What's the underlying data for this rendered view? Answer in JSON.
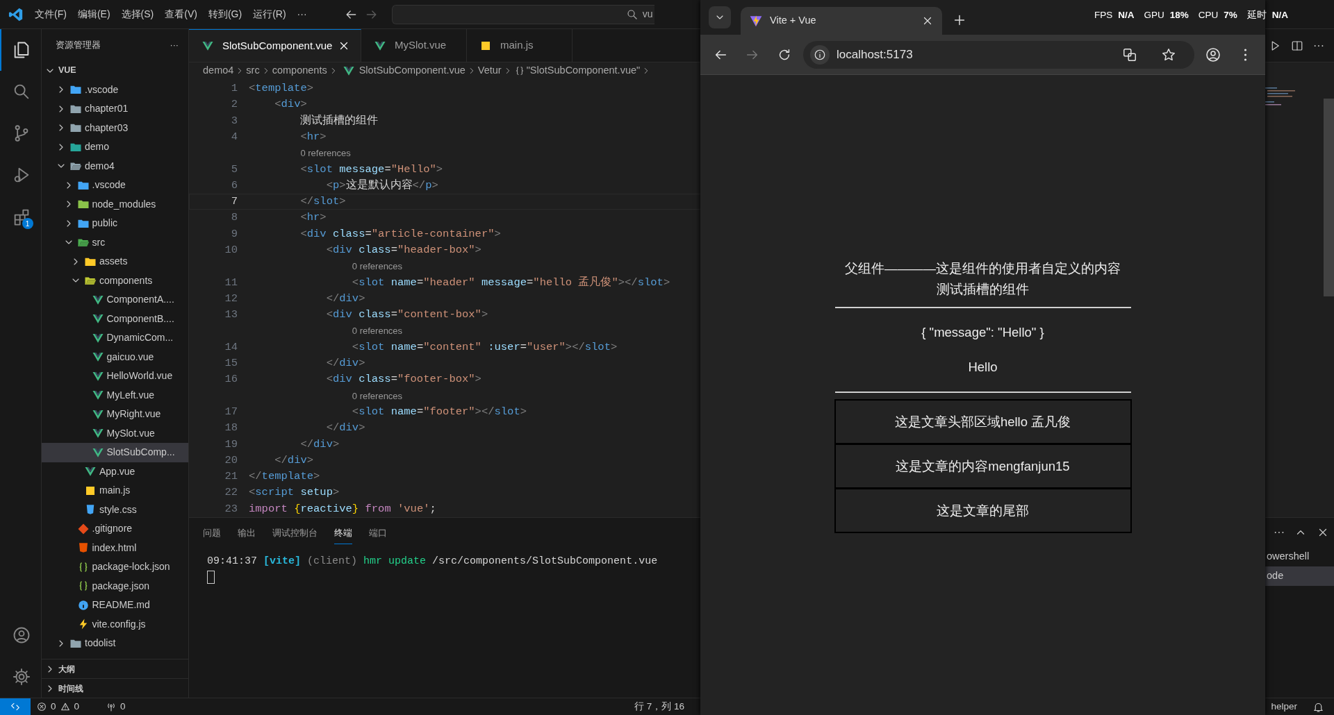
{
  "title_bar": {
    "menu": [
      "文件(F)",
      "编辑(E)",
      "选择(S)",
      "查看(V)",
      "转到(G)",
      "运行(R)"
    ],
    "more": "···",
    "nav": [
      {
        "kind": "back",
        "disabled": false
      },
      {
        "kind": "forward",
        "disabled": true
      }
    ],
    "search": {
      "value": "vu"
    }
  },
  "activity_bar": {
    "items": [
      {
        "kind": "explorer",
        "selected": true
      },
      {
        "kind": "search",
        "selected": false
      },
      {
        "kind": "source-control",
        "selected": false
      },
      {
        "kind": "run-debug",
        "selected": false
      },
      {
        "kind": "extensions",
        "selected": false,
        "badge": "1"
      }
    ],
    "bottom": [
      {
        "kind": "account"
      },
      {
        "kind": "settings"
      }
    ]
  },
  "sidebar": {
    "title": "资源管理器",
    "more": "···",
    "root": {
      "label": "VUE",
      "expanded": true
    },
    "tree": [
      {
        "label": ".vscode",
        "kind": "folder-vscode",
        "expanded": false,
        "selected": false
      },
      {
        "label": "chapter01",
        "kind": "folder",
        "expanded": false,
        "selected": false
      },
      {
        "label": "chapter03",
        "kind": "folder",
        "expanded": false,
        "selected": false
      },
      {
        "label": "demo",
        "kind": "folder-media",
        "expanded": false,
        "selected": false
      },
      {
        "label": "demo4",
        "kind": "folder",
        "expanded": true,
        "selected": false,
        "children": [
          {
            "label": ".vscode",
            "kind": "folder-vscode",
            "expanded": false,
            "selected": false
          },
          {
            "label": "node_modules",
            "kind": "folder-node",
            "expanded": false,
            "selected": false
          },
          {
            "label": "public",
            "kind": "folder-public",
            "expanded": false,
            "selected": false
          },
          {
            "label": "src",
            "kind": "folder-src",
            "expanded": true,
            "selected": false,
            "children": [
              {
                "label": "assets",
                "kind": "folder-assets",
                "expanded": false,
                "selected": false
              },
              {
                "label": "components",
                "kind": "folder-components",
                "expanded": true,
                "selected": false,
                "children": [
                  {
                    "label": "ComponentA....",
                    "kind": "vue",
                    "selected": false
                  },
                  {
                    "label": "ComponentB....",
                    "kind": "vue",
                    "selected": false
                  },
                  {
                    "label": "DynamicCom...",
                    "kind": "vue",
                    "selected": false
                  },
                  {
                    "label": "gaicuo.vue",
                    "kind": "vue",
                    "selected": false
                  },
                  {
                    "label": "HelloWorld.vue",
                    "kind": "vue",
                    "selected": false
                  },
                  {
                    "label": "MyLeft.vue",
                    "kind": "vue",
                    "selected": false
                  },
                  {
                    "label": "MyRight.vue",
                    "kind": "vue",
                    "selected": false
                  },
                  {
                    "label": "MySlot.vue",
                    "kind": "vue",
                    "selected": false
                  },
                  {
                    "label": "SlotSubComp...",
                    "kind": "vue",
                    "selected": true
                  }
                ]
              },
              {
                "label": "App.vue",
                "kind": "vue",
                "selected": false
              },
              {
                "label": "main.js",
                "kind": "js",
                "selected": false
              },
              {
                "label": "style.css",
                "kind": "css",
                "selected": false
              }
            ]
          },
          {
            "label": ".gitignore",
            "kind": "git",
            "selected": false
          },
          {
            "label": "index.html",
            "kind": "html",
            "selected": false
          },
          {
            "label": "package-lock.json",
            "kind": "json",
            "selected": false
          },
          {
            "label": "package.json",
            "kind": "json",
            "selected": false
          },
          {
            "label": "README.md",
            "kind": "info",
            "selected": false
          },
          {
            "label": "vite.config.js",
            "kind": "vite",
            "selected": false
          }
        ]
      },
      {
        "label": "todolist",
        "kind": "folder",
        "expanded": false,
        "selected": false
      }
    ],
    "sections": [
      {
        "label": "大纲",
        "expanded": false
      },
      {
        "label": "时间线",
        "expanded": false
      }
    ]
  },
  "editor": {
    "tabs": [
      {
        "label": "SlotSubComponent.vue",
        "kind": "vue",
        "selected": true
      },
      {
        "label": "MySlot.vue",
        "kind": "vue",
        "selected": false
      },
      {
        "label": "main.js",
        "kind": "js",
        "selected": false
      }
    ],
    "breadcrumbs": [
      {
        "label": "demo4",
        "kind": "plain"
      },
      {
        "label": "src",
        "kind": "plain"
      },
      {
        "label": "components",
        "kind": "plain"
      },
      {
        "label": "SlotSubComponent.vue",
        "kind": "vue"
      },
      {
        "label": "Vetur",
        "kind": "plain"
      },
      {
        "label": "\"SlotSubComponent.vue\"",
        "kind": "braces"
      }
    ],
    "actions_more": "···",
    "lines": [
      {
        "kind": "code",
        "number": "1",
        "current": false,
        "tokens": [
          {
            "kind": "punct",
            "text": "<"
          },
          {
            "kind": "tag",
            "text": "template"
          },
          {
            "kind": "punct",
            "text": ">"
          }
        ]
      },
      {
        "kind": "code",
        "number": "2",
        "current": false,
        "tokens": [
          {
            "kind": "punct",
            "text": "    <"
          },
          {
            "kind": "tag",
            "text": "div"
          },
          {
            "kind": "punct",
            "text": ">"
          }
        ]
      },
      {
        "kind": "code",
        "number": "3",
        "current": false,
        "tokens": [
          {
            "kind": "text",
            "text": "        测试插槽的组件"
          }
        ]
      },
      {
        "kind": "code",
        "number": "4",
        "current": false,
        "tokens": [
          {
            "kind": "punct",
            "text": "        <"
          },
          {
            "kind": "tag",
            "text": "hr"
          },
          {
            "kind": "punct",
            "text": ">"
          }
        ]
      },
      {
        "kind": "codelens",
        "text": "0 references"
      },
      {
        "kind": "code",
        "number": "5",
        "current": false,
        "tokens": [
          {
            "kind": "punct",
            "text": "        <"
          },
          {
            "kind": "tag",
            "text": "slot"
          },
          {
            "kind": "attr",
            "text": " message"
          },
          {
            "kind": "text",
            "text": "="
          },
          {
            "kind": "string",
            "text": "\"Hello\""
          },
          {
            "kind": "punct",
            "text": ">"
          }
        ]
      },
      {
        "kind": "code",
        "number": "6",
        "current": false,
        "tokens": [
          {
            "kind": "punct",
            "text": "            <"
          },
          {
            "kind": "tag",
            "text": "p"
          },
          {
            "kind": "punct",
            "text": ">"
          },
          {
            "kind": "text",
            "text": "这是默认内容"
          },
          {
            "kind": "punct",
            "text": "</"
          },
          {
            "kind": "tag",
            "text": "p"
          },
          {
            "kind": "punct",
            "text": ">"
          }
        ]
      },
      {
        "kind": "code",
        "number": "7",
        "current": true,
        "tokens": [
          {
            "kind": "punct",
            "text": "        </"
          },
          {
            "kind": "tag",
            "text": "slot"
          },
          {
            "kind": "punct",
            "text": ">"
          }
        ]
      },
      {
        "kind": "code",
        "number": "8",
        "current": false,
        "tokens": [
          {
            "kind": "punct",
            "text": "        <"
          },
          {
            "kind": "tag",
            "text": "hr"
          },
          {
            "kind": "punct",
            "text": ">"
          }
        ]
      },
      {
        "kind": "code",
        "number": "9",
        "current": false,
        "tokens": [
          {
            "kind": "punct",
            "text": "        <"
          },
          {
            "kind": "tag",
            "text": "div"
          },
          {
            "kind": "attr",
            "text": " class"
          },
          {
            "kind": "text",
            "text": "="
          },
          {
            "kind": "string",
            "text": "\"article-container\""
          },
          {
            "kind": "punct",
            "text": ">"
          }
        ]
      },
      {
        "kind": "code",
        "number": "10",
        "current": false,
        "tokens": [
          {
            "kind": "punct",
            "text": "            <"
          },
          {
            "kind": "tag",
            "text": "div"
          },
          {
            "kind": "attr",
            "text": " class"
          },
          {
            "kind": "text",
            "text": "="
          },
          {
            "kind": "string",
            "text": "\"header-box\""
          },
          {
            "kind": "punct",
            "text": ">"
          }
        ]
      },
      {
        "kind": "codelens",
        "text": "0 references"
      },
      {
        "kind": "code",
        "number": "11",
        "current": false,
        "tokens": [
          {
            "kind": "punct",
            "text": "                <"
          },
          {
            "kind": "tag",
            "text": "slot"
          },
          {
            "kind": "attr",
            "text": " name"
          },
          {
            "kind": "text",
            "text": "="
          },
          {
            "kind": "string",
            "text": "\"header\""
          },
          {
            "kind": "attr",
            "text": " message"
          },
          {
            "kind": "text",
            "text": "="
          },
          {
            "kind": "string",
            "text": "\"hello 孟凡俊\""
          },
          {
            "kind": "punct",
            "text": "></"
          },
          {
            "kind": "tag",
            "text": "slot"
          },
          {
            "kind": "punct",
            "text": ">"
          }
        ]
      },
      {
        "kind": "code",
        "number": "12",
        "current": false,
        "tokens": [
          {
            "kind": "punct",
            "text": "            </"
          },
          {
            "kind": "tag",
            "text": "div"
          },
          {
            "kind": "punct",
            "text": ">"
          }
        ]
      },
      {
        "kind": "code",
        "number": "13",
        "current": false,
        "tokens": [
          {
            "kind": "punct",
            "text": "            <"
          },
          {
            "kind": "tag",
            "text": "div"
          },
          {
            "kind": "attr",
            "text": " class"
          },
          {
            "kind": "text",
            "text": "="
          },
          {
            "kind": "string",
            "text": "\"content-box\""
          },
          {
            "kind": "punct",
            "text": ">"
          }
        ]
      },
      {
        "kind": "codelens",
        "text": "0 references"
      },
      {
        "kind": "code",
        "number": "14",
        "current": false,
        "tokens": [
          {
            "kind": "punct",
            "text": "                <"
          },
          {
            "kind": "tag",
            "text": "slot"
          },
          {
            "kind": "attr",
            "text": " name"
          },
          {
            "kind": "text",
            "text": "="
          },
          {
            "kind": "string",
            "text": "\"content\""
          },
          {
            "kind": "attr",
            "text": " :user"
          },
          {
            "kind": "text",
            "text": "="
          },
          {
            "kind": "string",
            "text": "\"user\""
          },
          {
            "kind": "punct",
            "text": "></"
          },
          {
            "kind": "tag",
            "text": "slot"
          },
          {
            "kind": "punct",
            "text": ">"
          }
        ]
      },
      {
        "kind": "code",
        "number": "15",
        "current": false,
        "tokens": [
          {
            "kind": "punct",
            "text": "            </"
          },
          {
            "kind": "tag",
            "text": "div"
          },
          {
            "kind": "punct",
            "text": ">"
          }
        ]
      },
      {
        "kind": "code",
        "number": "16",
        "current": false,
        "tokens": [
          {
            "kind": "punct",
            "text": "            <"
          },
          {
            "kind": "tag",
            "text": "div"
          },
          {
            "kind": "attr",
            "text": " class"
          },
          {
            "kind": "text",
            "text": "="
          },
          {
            "kind": "string",
            "text": "\"footer-box\""
          },
          {
            "kind": "punct",
            "text": ">"
          }
        ]
      },
      {
        "kind": "codelens",
        "text": "0 references"
      },
      {
        "kind": "code",
        "number": "17",
        "current": false,
        "tokens": [
          {
            "kind": "punct",
            "text": "                <"
          },
          {
            "kind": "tag",
            "text": "slot"
          },
          {
            "kind": "attr",
            "text": " name"
          },
          {
            "kind": "text",
            "text": "="
          },
          {
            "kind": "string",
            "text": "\"footer\""
          },
          {
            "kind": "punct",
            "text": "></"
          },
          {
            "kind": "tag",
            "text": "slot"
          },
          {
            "kind": "punct",
            "text": ">"
          }
        ]
      },
      {
        "kind": "code",
        "number": "18",
        "current": false,
        "tokens": [
          {
            "kind": "punct",
            "text": "            </"
          },
          {
            "kind": "tag",
            "text": "div"
          },
          {
            "kind": "punct",
            "text": ">"
          }
        ]
      },
      {
        "kind": "code",
        "number": "19",
        "current": false,
        "tokens": [
          {
            "kind": "punct",
            "text": "        </"
          },
          {
            "kind": "tag",
            "text": "div"
          },
          {
            "kind": "punct",
            "text": ">"
          }
        ]
      },
      {
        "kind": "code",
        "number": "20",
        "current": false,
        "tokens": [
          {
            "kind": "punct",
            "text": "    </"
          },
          {
            "kind": "tag",
            "text": "div"
          },
          {
            "kind": "punct",
            "text": ">"
          }
        ]
      },
      {
        "kind": "code",
        "number": "21",
        "current": false,
        "tokens": [
          {
            "kind": "punct",
            "text": "</"
          },
          {
            "kind": "tag",
            "text": "template"
          },
          {
            "kind": "punct",
            "text": ">"
          }
        ]
      },
      {
        "kind": "code",
        "number": "22",
        "current": false,
        "tokens": [
          {
            "kind": "punct",
            "text": "<"
          },
          {
            "kind": "tag",
            "text": "script"
          },
          {
            "kind": "attr",
            "text": " setup"
          },
          {
            "kind": "punct",
            "text": ">"
          }
        ]
      },
      {
        "kind": "code",
        "number": "23",
        "current": false,
        "tokens": [
          {
            "kind": "keyword",
            "text": "import "
          },
          {
            "kind": "bracket",
            "text": "{"
          },
          {
            "kind": "attr",
            "text": "reactive"
          },
          {
            "kind": "bracket",
            "text": "}"
          },
          {
            "kind": "keyword",
            "text": " from "
          },
          {
            "kind": "string",
            "text": "'vue'"
          },
          {
            "kind": "text",
            "text": ";"
          }
        ]
      }
    ]
  },
  "panel": {
    "tabs": [
      {
        "label": "问题",
        "selected": false
      },
      {
        "label": "输出",
        "selected": false
      },
      {
        "label": "调试控制台",
        "selected": false
      },
      {
        "label": "终端",
        "selected": true
      },
      {
        "label": "端口",
        "selected": false
      }
    ],
    "more": "···",
    "terminal": [
      {
        "tokens": [
          {
            "kind": "text",
            "text": "09:41:37 "
          },
          {
            "kind": "label",
            "text": "[vite]"
          },
          {
            "kind": "dim",
            "text": " (client)"
          },
          {
            "kind": "success",
            "text": " hmr update"
          },
          {
            "kind": "text",
            "text": " /src/components/SlotSubComponent.vue"
          }
        ]
      }
    ],
    "terminals": [
      {
        "label": "owershell",
        "selected": false
      },
      {
        "label": "ode",
        "selected": true
      }
    ]
  },
  "status_bar": {
    "errors": "0",
    "warnings": "0",
    "ports": "0",
    "cursor": "行 7，列 16",
    "right": "helper"
  },
  "browser": {
    "tab": {
      "title": "Vite + Vue",
      "selected": true
    },
    "nav": [
      {
        "kind": "back",
        "disabled": false
      },
      {
        "kind": "forward",
        "disabled": true
      },
      {
        "kind": "reload",
        "disabled": false
      }
    ],
    "url": "localhost:5173",
    "page": {
      "heading": "父组件————这是组件的使用者自定义的内容",
      "subtitle": "测试插槽的组件",
      "json": "{ \"message\": \"Hello\" }",
      "message": "Hello",
      "boxes": [
        "这是文章头部区域hello 孟凡俊",
        "这是文章的内容mengfanjun15",
        "这是文章的尾部"
      ]
    }
  },
  "overlay": {
    "stats": [
      {
        "label": "FPS",
        "value": "N/A"
      },
      {
        "label": "GPU",
        "value": "18%"
      },
      {
        "label": "CPU",
        "value": "7%"
      },
      {
        "label": "延时",
        "value": "N/A"
      }
    ]
  }
}
